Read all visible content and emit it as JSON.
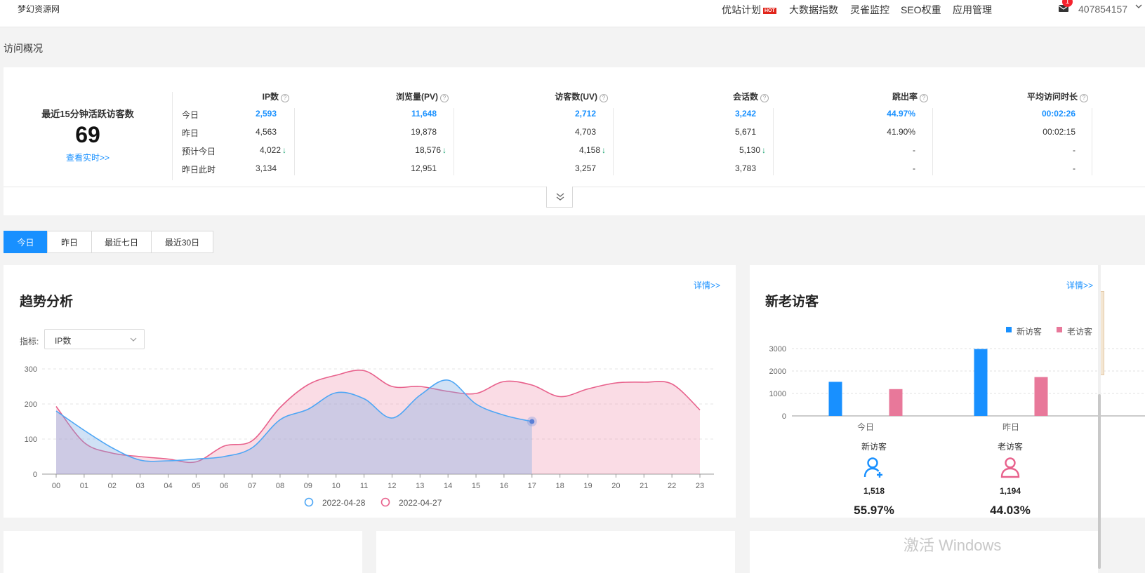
{
  "topbar": {
    "logo": "梦幻资源网",
    "nav": [
      {
        "label": "优站计划",
        "badge": "HOT"
      },
      {
        "label": "大数据指数"
      },
      {
        "label": "灵雀监控"
      },
      {
        "label": "SEO权重"
      },
      {
        "label": "应用管理"
      }
    ],
    "mail_badge": "1",
    "user": "407854157"
  },
  "page_title": "访问概况",
  "overview": {
    "active_title": "最近15分钟活跃访客数",
    "active_count": "69",
    "active_link": "查看实时>>",
    "row_labels": [
      "今日",
      "昨日",
      "预计今日",
      "昨日此时"
    ],
    "columns": [
      {
        "header": "IP数",
        "values": [
          "2,593",
          "4,563",
          "4,022",
          "3,134"
        ],
        "trend": "↓"
      },
      {
        "header": "浏览量(PV)",
        "values": [
          "11,648",
          "19,878",
          "18,576",
          "12,951"
        ],
        "trend": "↓"
      },
      {
        "header": "访客数(UV)",
        "values": [
          "2,712",
          "4,703",
          "4,158",
          "3,257"
        ],
        "trend": "↓"
      },
      {
        "header": "会话数",
        "values": [
          "3,242",
          "5,671",
          "5,130",
          "3,783"
        ],
        "trend": "↓"
      },
      {
        "header": "跳出率",
        "values": [
          "44.97%",
          "41.90%",
          "-",
          "-"
        ],
        "trend": ""
      },
      {
        "header": "平均访问时长",
        "values": [
          "00:02:26",
          "00:02:15",
          "-",
          "-"
        ],
        "trend": ""
      }
    ]
  },
  "tabs": [
    "今日",
    "昨日",
    "最近七日",
    "最近30日"
  ],
  "active_tab": "今日",
  "trend": {
    "title": "趋势分析",
    "more": "详情>>",
    "metric_label": "指标:",
    "metric_value": "IP数"
  },
  "visitors": {
    "title": "新老访客",
    "more": "详情>>",
    "new_label": "新访客",
    "old_label": "老访客",
    "new_count": "1,518",
    "old_count": "1,194",
    "new_pct": "55.97%",
    "old_pct": "44.03%"
  },
  "watermark": "激活 Windows",
  "colors": {
    "accent": "#1890ff",
    "series1": "#4da6f5",
    "series2": "#e8618c",
    "old_bar": "#e8789a"
  },
  "chart_data": [
    {
      "type": "area",
      "ylim": [
        0,
        300
      ],
      "yticks": [
        0,
        100,
        200,
        300
      ],
      "categories": [
        "00",
        "01",
        "02",
        "03",
        "04",
        "05",
        "06",
        "07",
        "08",
        "09",
        "10",
        "11",
        "12",
        "13",
        "14",
        "15",
        "16",
        "17",
        "18",
        "19",
        "20",
        "21",
        "22",
        "23"
      ],
      "series": [
        {
          "name": "2022-04-28",
          "values": [
            180,
            125,
            75,
            40,
            38,
            43,
            50,
            75,
            155,
            185,
            232,
            215,
            160,
            225,
            268,
            200,
            168,
            150
          ]
        },
        {
          "name": "2022-04-27",
          "values": [
            193,
            90,
            60,
            50,
            43,
            35,
            80,
            95,
            190,
            255,
            282,
            295,
            250,
            250,
            236,
            230,
            264,
            254,
            221,
            243,
            260,
            262,
            257,
            183
          ]
        }
      ],
      "grid": true,
      "legend": "bottom"
    },
    {
      "type": "bar",
      "categories": [
        "今日",
        "昨日"
      ],
      "ylim": [
        0,
        3000
      ],
      "yticks": [
        0,
        1000,
        2000,
        3000
      ],
      "series": [
        {
          "name": "新访客",
          "values": [
            1518,
            2980
          ]
        },
        {
          "name": "老访客",
          "values": [
            1194,
            1730
          ]
        }
      ],
      "grid": true,
      "legend": "top-right"
    }
  ]
}
